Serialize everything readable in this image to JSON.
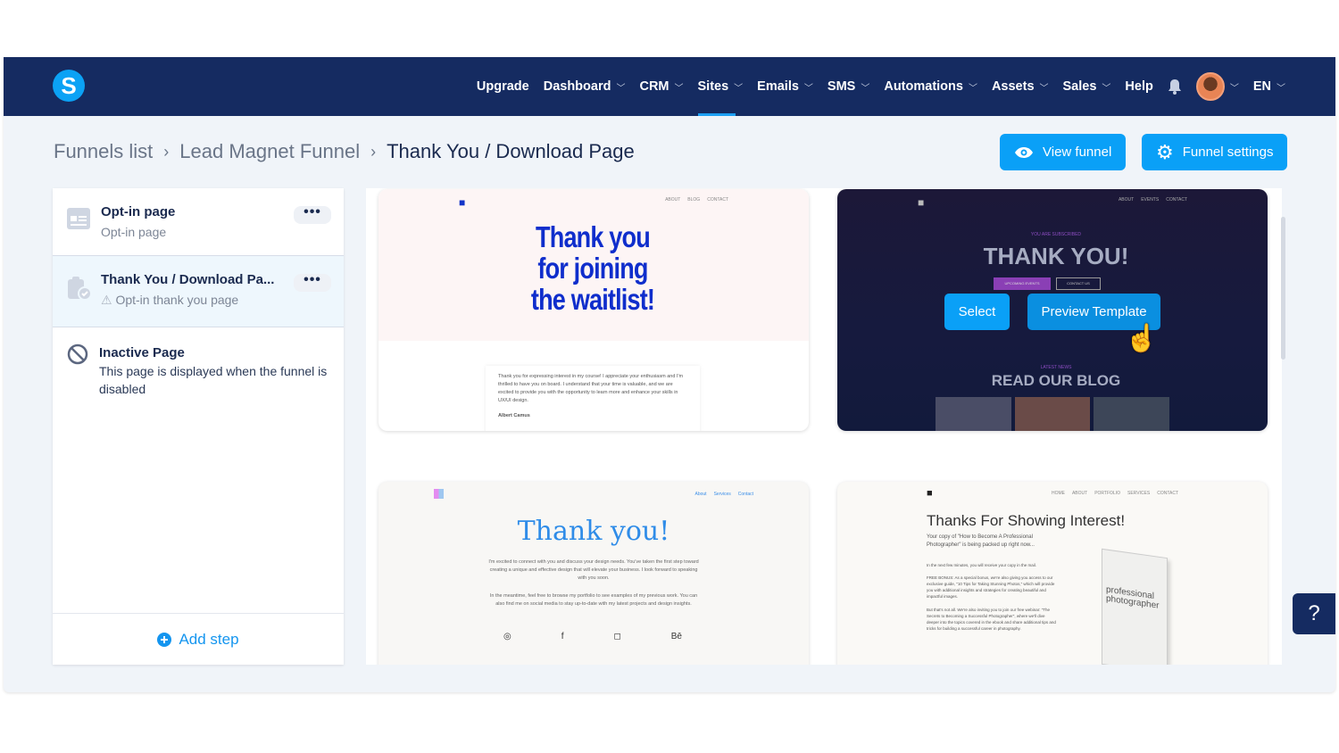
{
  "nav": {
    "logo": "S",
    "items": [
      {
        "label": "Upgrade",
        "chev": false
      },
      {
        "label": "Dashboard",
        "chev": true
      },
      {
        "label": "CRM",
        "chev": true
      },
      {
        "label": "Sites",
        "chev": true,
        "active": true
      },
      {
        "label": "Emails",
        "chev": true
      },
      {
        "label": "SMS",
        "chev": true
      },
      {
        "label": "Automations",
        "chev": true
      },
      {
        "label": "Assets",
        "chev": true
      },
      {
        "label": "Sales",
        "chev": true
      },
      {
        "label": "Help",
        "chev": false
      }
    ],
    "lang": "EN",
    "chev": "﹀"
  },
  "breadcrumb": {
    "items": [
      "Funnels list",
      "Lead Magnet Funnel"
    ],
    "current": "Thank You / Download Page",
    "sep": "›"
  },
  "actions": {
    "view": "View funnel",
    "settings": "Funnel settings"
  },
  "steps": [
    {
      "title": "Opt-in page",
      "sub": "Opt-in page",
      "menu": "•••"
    },
    {
      "title": "Thank You / Download Pa...",
      "sub": "Opt-in thank you page",
      "menu": "•••"
    },
    {
      "title": "Inactive Page",
      "sub": "This page is displayed when the funnel is disabled"
    }
  ],
  "add_step": "Add step",
  "templates": [
    {
      "nav": [
        "ABOUT",
        "BLOG",
        "CONTACT"
      ],
      "heading": "Thank you for joining the waitlist!",
      "body": "Thank you for expressing interest in my course! I appreciate your enthusiasm and I'm thrilled to have you on board. I understand that your time is valuable, and we are excited to provide you with the opportunity to learn more and enhance your skills in UX/UI design.",
      "author": "Albert Camus"
    },
    {
      "nav": [
        "ABOUT",
        "EVENTS",
        "CONTACT"
      ],
      "kicker": "YOU ARE SUBSCRIBED",
      "heading": "THANK YOU!",
      "b1": "UPCOMING EVENTS",
      "b2": "CONTACT US",
      "select": "Select",
      "preview": "Preview Template",
      "kicker2": "LATEST NEWS",
      "heading2": "READ OUR BLOG"
    },
    {
      "nav": [
        "About",
        "Services",
        "Contact"
      ],
      "heading": "Thank you!",
      "p1": "I'm excited to connect with you and discuss your design needs. You've taken the first step toward creating a unique and effective design that will elevate your business. I look forward to speaking with you soon.",
      "p2": "In the meantime, feel free to browse my portfolio to see examples of my previous work. You can also find me on social media to stay up-to-date with my latest projects and design insights.",
      "social": [
        "◎",
        "f",
        "◻",
        "Bē"
      ]
    },
    {
      "nav": [
        "HOME",
        "ABOUT",
        "PORTFOLIO",
        "SERVICES",
        "CONTACT"
      ],
      "heading": "Thanks For Showing Interest!",
      "sub": "Your copy of \"How to Become A Professional Photographer\" is being packed up right now...",
      "p1": "In the next few minutes, you will receive your copy in the mail.",
      "p2": "FREE BONUS: As a special bonus, we're also giving you access to our exclusive guide, \"10 Tips for Taking Stunning Photos,\" which will provide you with additional insights and strategies for creating beautiful and impactful images.",
      "p3": "But that's not all. We're also inviting you to join our free webinar: \"The Secrets to Becoming a Successful Photographer\", where we'll dive deeper into the topics covered in the ebook and share additional tips and tricks for building a successful career in photography.",
      "book": "professional photographer"
    }
  ],
  "help": "?"
}
